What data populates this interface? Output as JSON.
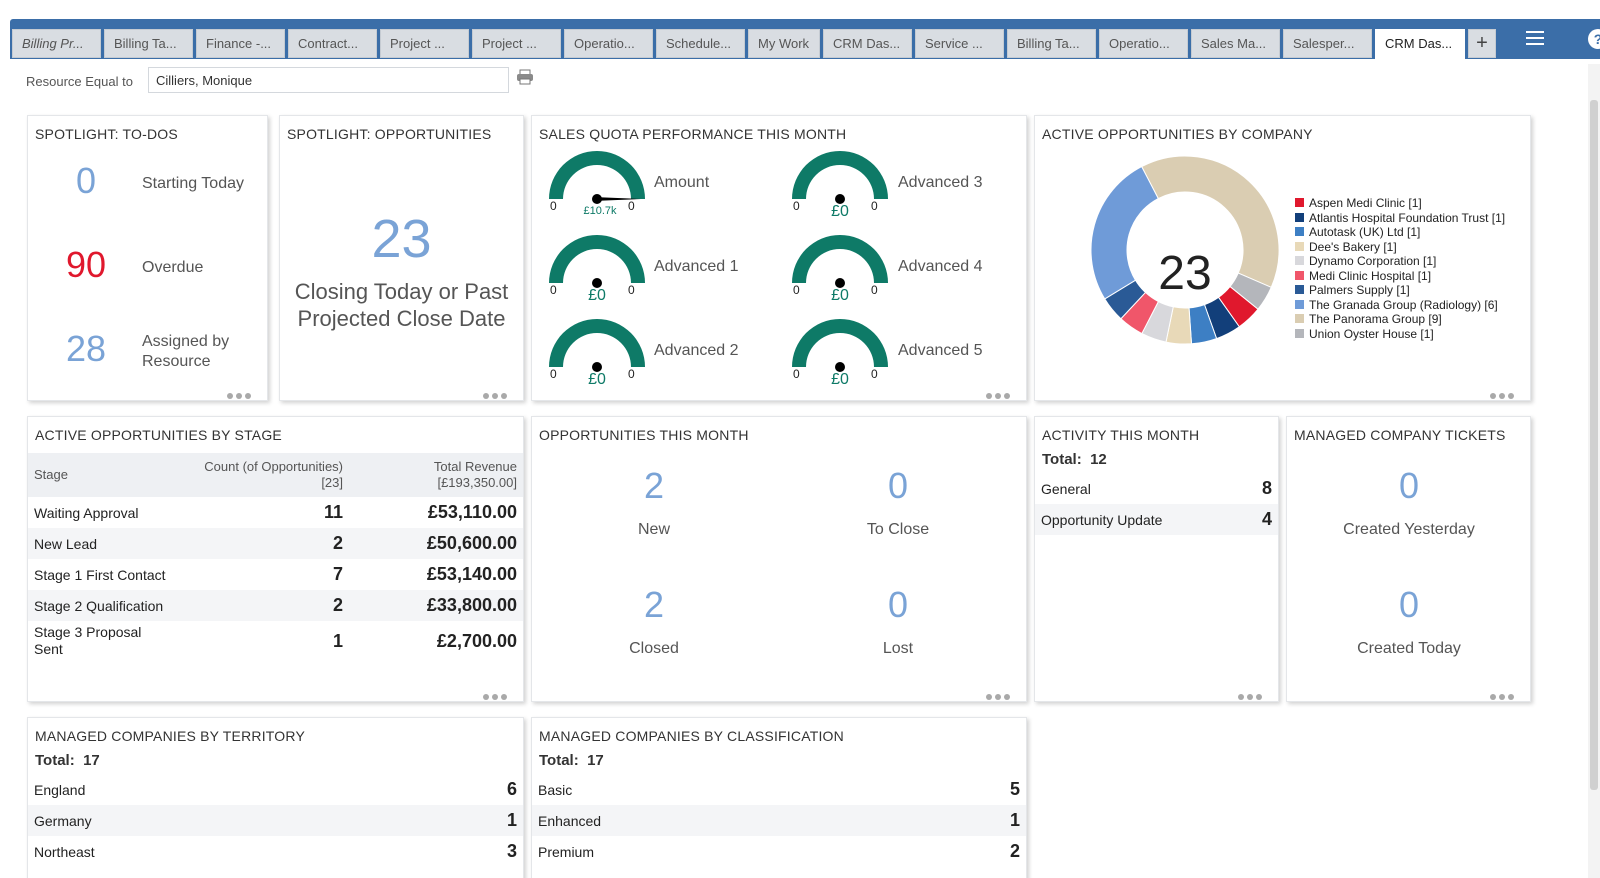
{
  "tabs": [
    {
      "label": "Billing Pr..."
    },
    {
      "label": "Billing Ta..."
    },
    {
      "label": "Finance -..."
    },
    {
      "label": "Contract..."
    },
    {
      "label": "Project ..."
    },
    {
      "label": "Project ..."
    },
    {
      "label": "Operatio..."
    },
    {
      "label": "Schedule..."
    },
    {
      "label": "My Work"
    },
    {
      "label": "CRM Das..."
    },
    {
      "label": "Service ..."
    },
    {
      "label": "Billing Ta..."
    },
    {
      "label": "Operatio..."
    },
    {
      "label": "Sales Ma..."
    },
    {
      "label": "Salesper..."
    },
    {
      "label": "CRM Das..."
    }
  ],
  "tab_add_label": "+",
  "help_label": "?",
  "filter": {
    "label": "Resource Equal to",
    "value": "Cilliers, Monique"
  },
  "todos": {
    "title": "SPOTLIGHT: TO-DOS",
    "items": [
      {
        "value": "0",
        "label": "Starting Today"
      },
      {
        "value": "90",
        "label": "Overdue"
      },
      {
        "value": "28",
        "label_line1": "Assigned by",
        "label_line2": "Resource"
      }
    ]
  },
  "spot_opps": {
    "title": "SPOTLIGHT: OPPORTUNITIES",
    "value": "23",
    "line1": "Closing Today or Past",
    "line2": "Projected Close Date"
  },
  "quota": {
    "title": "SALES QUOTA PERFORMANCE THIS MONTH",
    "gauges": [
      {
        "label": "Amount",
        "min": "0",
        "max": "0",
        "value": "£10.7k"
      },
      {
        "label": "Advanced 3",
        "min": "0",
        "max": "0",
        "value": "£0"
      },
      {
        "label": "Advanced 1",
        "min": "0",
        "max": "0",
        "value": "£0"
      },
      {
        "label": "Advanced 4",
        "min": "0",
        "max": "0",
        "value": "£0"
      },
      {
        "label": "Advanced 2",
        "min": "0",
        "max": "0",
        "value": "£0"
      },
      {
        "label": "Advanced 5",
        "min": "0",
        "max": "0",
        "value": "£0"
      }
    ],
    "gauge_color": "#0e7a67"
  },
  "by_company": {
    "title": "ACTIVE OPPORTUNITIES BY COMPANY",
    "center": "23",
    "legend": [
      {
        "label": "Aspen Medi Clinic  [1]",
        "color": "#e0182d"
      },
      {
        "label": "Atlantis Hospital Foundation Trust [1]",
        "color": "#123f7a"
      },
      {
        "label": "Autotask (UK) Ltd [1]",
        "color": "#3d7fc4"
      },
      {
        "label": "Dee's Bakery [1]",
        "color": "#e8d9b8"
      },
      {
        "label": "Dynamo Corporation [1]",
        "color": "#d8d8dc"
      },
      {
        "label": "Medi Clinic Hospital [1]",
        "color": "#f0566a"
      },
      {
        "label": "Palmers Supply [1]",
        "color": "#2a5a96"
      },
      {
        "label": "The Granada Group (Radiology) [6]",
        "color": "#6f9bd8"
      },
      {
        "label": "The Panorama Group [9]",
        "color": "#dacdb2"
      },
      {
        "label": "Union Oyster House [1]",
        "color": "#b4b6bb"
      }
    ]
  },
  "chart_data": {
    "type": "pie",
    "categories": [
      "Aspen Medi Clinic",
      "Atlantis Hospital Foundation Trust",
      "Autotask (UK) Ltd",
      "Dee's Bakery",
      "Dynamo Corporation",
      "Medi Clinic Hospital",
      "Palmers Supply",
      "The Granada Group (Radiology)",
      "The Panorama Group",
      "Union Oyster House"
    ],
    "values": [
      1,
      1,
      1,
      1,
      1,
      1,
      1,
      6,
      9,
      1
    ],
    "order": [
      "The Panorama Group",
      "Union Oyster House",
      "Aspen Medi Clinic",
      "Atlantis Hospital Foundation Trust",
      "Autotask (UK) Ltd",
      "Dee's Bakery",
      "Dynamo Corporation",
      "Medi Clinic Hospital",
      "Palmers Supply",
      "The Granada Group (Radiology)"
    ],
    "title": "ACTIVE OPPORTUNITIES BY COMPANY"
  },
  "by_stage": {
    "title": "ACTIVE OPPORTUNITIES BY STAGE",
    "col1": "Stage",
    "col2_line1": "Count (of Opportunities)",
    "col2_line2": "[23]",
    "col3_line1": "Total Revenue",
    "col3_line2": "[£193,350.00]",
    "rows": [
      {
        "stage": "Waiting Approval",
        "count": "11",
        "revenue": "£53,110.00"
      },
      {
        "stage": "New Lead",
        "count": "2",
        "revenue": "£50,600.00"
      },
      {
        "stage": "Stage 1 First Contact",
        "count": "7",
        "revenue": "£53,140.00"
      },
      {
        "stage": "Stage 2 Qualification",
        "count": "2",
        "revenue": "£33,800.00"
      },
      {
        "stage": "Stage 3 Proposal",
        "stage_line2": "Sent",
        "count": "1",
        "revenue": "£2,700.00"
      }
    ]
  },
  "opps_month": {
    "title": "OPPORTUNITIES THIS MONTH",
    "items": [
      {
        "value": "2",
        "label": "New"
      },
      {
        "value": "0",
        "label": "To Close"
      },
      {
        "value": "2",
        "label": "Closed"
      },
      {
        "value": "0",
        "label": "Lost"
      }
    ]
  },
  "activity": {
    "title": "ACTIVITY THIS MONTH",
    "total_label": "Total:",
    "total": "12",
    "rows": [
      {
        "label": "General",
        "value": "8"
      },
      {
        "label": "Opportunity Update",
        "value": "4"
      }
    ]
  },
  "tickets": {
    "title": "MANAGED COMPANY TICKETS",
    "items": [
      {
        "value": "0",
        "label": "Created Yesterday"
      },
      {
        "value": "0",
        "label": "Created Today"
      }
    ]
  },
  "territory": {
    "title": "MANAGED COMPANIES BY TERRITORY",
    "total_label": "Total:",
    "total": "17",
    "rows": [
      {
        "label": "England",
        "value": "6"
      },
      {
        "label": "Germany",
        "value": "1"
      },
      {
        "label": "Northeast",
        "value": "3"
      }
    ]
  },
  "classification": {
    "title": "MANAGED COMPANIES BY CLASSIFICATION",
    "total_label": "Total:",
    "total": "17",
    "rows": [
      {
        "label": "Basic",
        "value": "5"
      },
      {
        "label": "Enhanced",
        "value": "1"
      },
      {
        "label": "Premium",
        "value": "2"
      }
    ]
  }
}
